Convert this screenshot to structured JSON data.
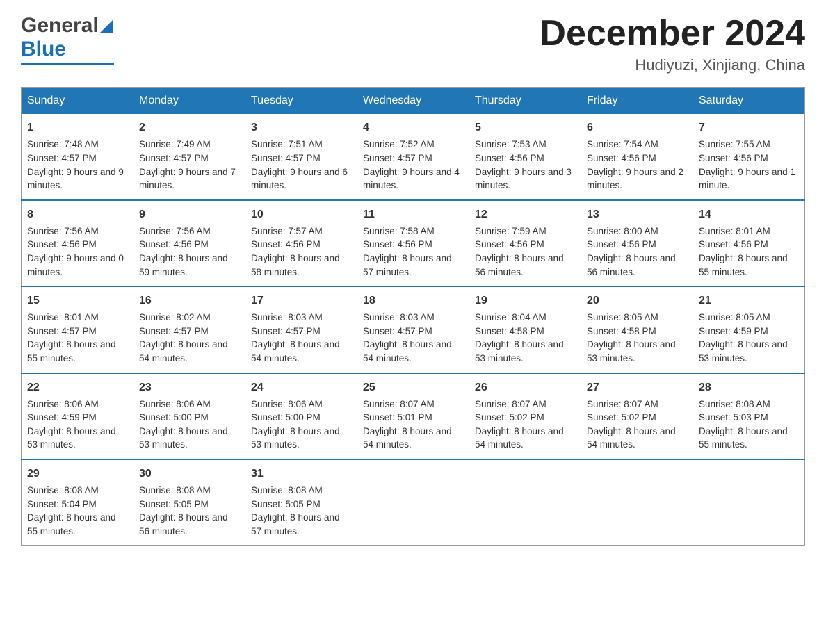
{
  "header": {
    "logo_general": "General",
    "logo_blue": "Blue",
    "month": "December 2024",
    "location": "Hudiyuzi, Xinjiang, China"
  },
  "days_of_week": [
    "Sunday",
    "Monday",
    "Tuesday",
    "Wednesday",
    "Thursday",
    "Friday",
    "Saturday"
  ],
  "weeks": [
    [
      {
        "day": "1",
        "sunrise": "Sunrise: 7:48 AM",
        "sunset": "Sunset: 4:57 PM",
        "daylight": "Daylight: 9 hours and 9 minutes."
      },
      {
        "day": "2",
        "sunrise": "Sunrise: 7:49 AM",
        "sunset": "Sunset: 4:57 PM",
        "daylight": "Daylight: 9 hours and 7 minutes."
      },
      {
        "day": "3",
        "sunrise": "Sunrise: 7:51 AM",
        "sunset": "Sunset: 4:57 PM",
        "daylight": "Daylight: 9 hours and 6 minutes."
      },
      {
        "day": "4",
        "sunrise": "Sunrise: 7:52 AM",
        "sunset": "Sunset: 4:57 PM",
        "daylight": "Daylight: 9 hours and 4 minutes."
      },
      {
        "day": "5",
        "sunrise": "Sunrise: 7:53 AM",
        "sunset": "Sunset: 4:56 PM",
        "daylight": "Daylight: 9 hours and 3 minutes."
      },
      {
        "day": "6",
        "sunrise": "Sunrise: 7:54 AM",
        "sunset": "Sunset: 4:56 PM",
        "daylight": "Daylight: 9 hours and 2 minutes."
      },
      {
        "day": "7",
        "sunrise": "Sunrise: 7:55 AM",
        "sunset": "Sunset: 4:56 PM",
        "daylight": "Daylight: 9 hours and 1 minute."
      }
    ],
    [
      {
        "day": "8",
        "sunrise": "Sunrise: 7:56 AM",
        "sunset": "Sunset: 4:56 PM",
        "daylight": "Daylight: 9 hours and 0 minutes."
      },
      {
        "day": "9",
        "sunrise": "Sunrise: 7:56 AM",
        "sunset": "Sunset: 4:56 PM",
        "daylight": "Daylight: 8 hours and 59 minutes."
      },
      {
        "day": "10",
        "sunrise": "Sunrise: 7:57 AM",
        "sunset": "Sunset: 4:56 PM",
        "daylight": "Daylight: 8 hours and 58 minutes."
      },
      {
        "day": "11",
        "sunrise": "Sunrise: 7:58 AM",
        "sunset": "Sunset: 4:56 PM",
        "daylight": "Daylight: 8 hours and 57 minutes."
      },
      {
        "day": "12",
        "sunrise": "Sunrise: 7:59 AM",
        "sunset": "Sunset: 4:56 PM",
        "daylight": "Daylight: 8 hours and 56 minutes."
      },
      {
        "day": "13",
        "sunrise": "Sunrise: 8:00 AM",
        "sunset": "Sunset: 4:56 PM",
        "daylight": "Daylight: 8 hours and 56 minutes."
      },
      {
        "day": "14",
        "sunrise": "Sunrise: 8:01 AM",
        "sunset": "Sunset: 4:56 PM",
        "daylight": "Daylight: 8 hours and 55 minutes."
      }
    ],
    [
      {
        "day": "15",
        "sunrise": "Sunrise: 8:01 AM",
        "sunset": "Sunset: 4:57 PM",
        "daylight": "Daylight: 8 hours and 55 minutes."
      },
      {
        "day": "16",
        "sunrise": "Sunrise: 8:02 AM",
        "sunset": "Sunset: 4:57 PM",
        "daylight": "Daylight: 8 hours and 54 minutes."
      },
      {
        "day": "17",
        "sunrise": "Sunrise: 8:03 AM",
        "sunset": "Sunset: 4:57 PM",
        "daylight": "Daylight: 8 hours and 54 minutes."
      },
      {
        "day": "18",
        "sunrise": "Sunrise: 8:03 AM",
        "sunset": "Sunset: 4:57 PM",
        "daylight": "Daylight: 8 hours and 54 minutes."
      },
      {
        "day": "19",
        "sunrise": "Sunrise: 8:04 AM",
        "sunset": "Sunset: 4:58 PM",
        "daylight": "Daylight: 8 hours and 53 minutes."
      },
      {
        "day": "20",
        "sunrise": "Sunrise: 8:05 AM",
        "sunset": "Sunset: 4:58 PM",
        "daylight": "Daylight: 8 hours and 53 minutes."
      },
      {
        "day": "21",
        "sunrise": "Sunrise: 8:05 AM",
        "sunset": "Sunset: 4:59 PM",
        "daylight": "Daylight: 8 hours and 53 minutes."
      }
    ],
    [
      {
        "day": "22",
        "sunrise": "Sunrise: 8:06 AM",
        "sunset": "Sunset: 4:59 PM",
        "daylight": "Daylight: 8 hours and 53 minutes."
      },
      {
        "day": "23",
        "sunrise": "Sunrise: 8:06 AM",
        "sunset": "Sunset: 5:00 PM",
        "daylight": "Daylight: 8 hours and 53 minutes."
      },
      {
        "day": "24",
        "sunrise": "Sunrise: 8:06 AM",
        "sunset": "Sunset: 5:00 PM",
        "daylight": "Daylight: 8 hours and 53 minutes."
      },
      {
        "day": "25",
        "sunrise": "Sunrise: 8:07 AM",
        "sunset": "Sunset: 5:01 PM",
        "daylight": "Daylight: 8 hours and 54 minutes."
      },
      {
        "day": "26",
        "sunrise": "Sunrise: 8:07 AM",
        "sunset": "Sunset: 5:02 PM",
        "daylight": "Daylight: 8 hours and 54 minutes."
      },
      {
        "day": "27",
        "sunrise": "Sunrise: 8:07 AM",
        "sunset": "Sunset: 5:02 PM",
        "daylight": "Daylight: 8 hours and 54 minutes."
      },
      {
        "day": "28",
        "sunrise": "Sunrise: 8:08 AM",
        "sunset": "Sunset: 5:03 PM",
        "daylight": "Daylight: 8 hours and 55 minutes."
      }
    ],
    [
      {
        "day": "29",
        "sunrise": "Sunrise: 8:08 AM",
        "sunset": "Sunset: 5:04 PM",
        "daylight": "Daylight: 8 hours and 55 minutes."
      },
      {
        "day": "30",
        "sunrise": "Sunrise: 8:08 AM",
        "sunset": "Sunset: 5:05 PM",
        "daylight": "Daylight: 8 hours and 56 minutes."
      },
      {
        "day": "31",
        "sunrise": "Sunrise: 8:08 AM",
        "sunset": "Sunset: 5:05 PM",
        "daylight": "Daylight: 8 hours and 57 minutes."
      },
      {
        "day": "",
        "sunrise": "",
        "sunset": "",
        "daylight": ""
      },
      {
        "day": "",
        "sunrise": "",
        "sunset": "",
        "daylight": ""
      },
      {
        "day": "",
        "sunrise": "",
        "sunset": "",
        "daylight": ""
      },
      {
        "day": "",
        "sunrise": "",
        "sunset": "",
        "daylight": ""
      }
    ]
  ]
}
